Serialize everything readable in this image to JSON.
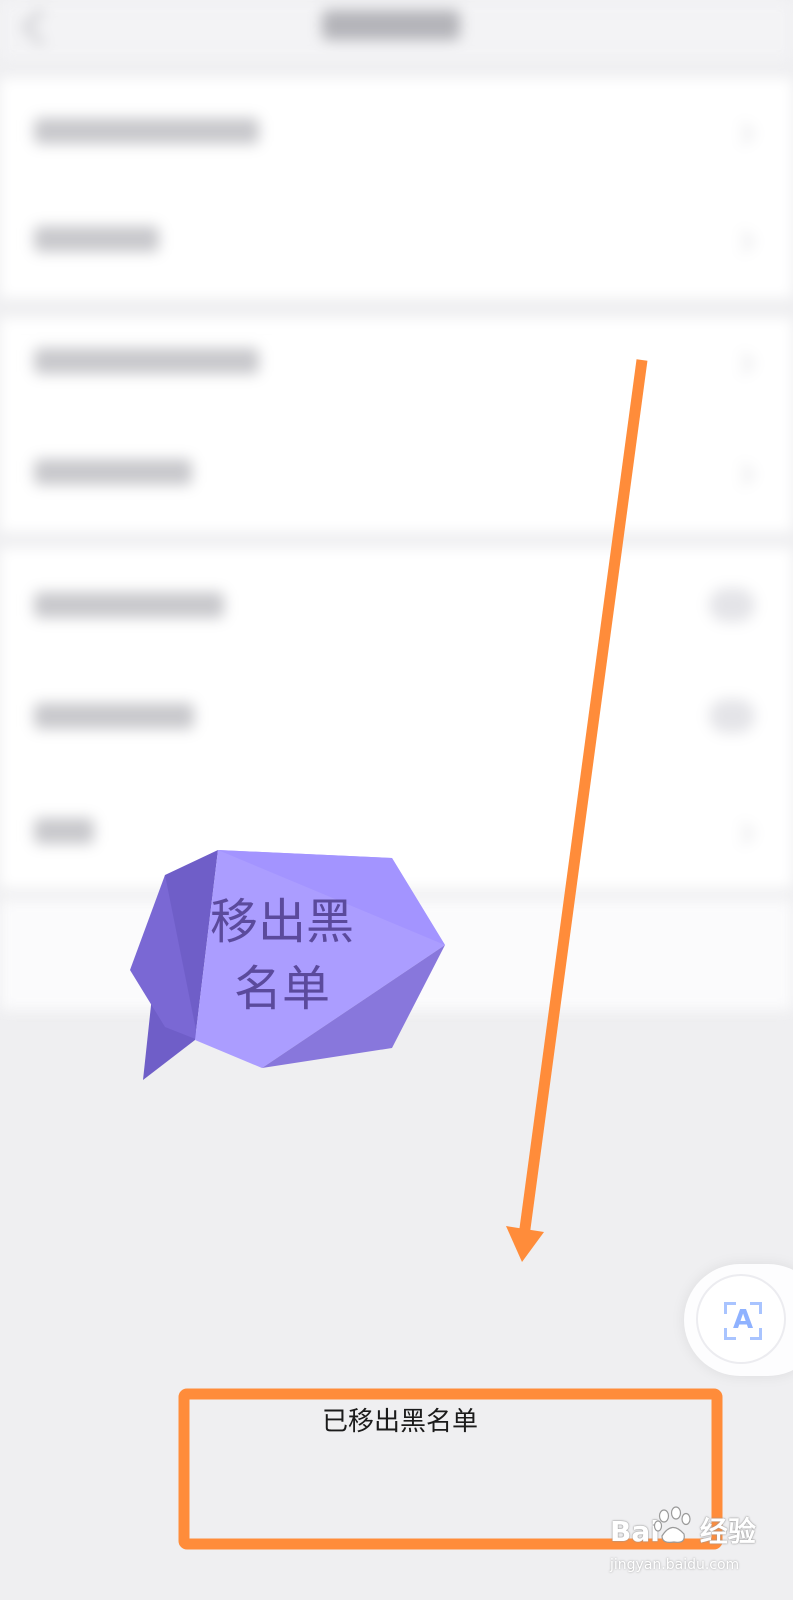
{
  "toast": {
    "message": "已移出黑名单"
  },
  "annotation": {
    "bubble_line1": "移出黑",
    "bubble_line2": "名单",
    "arrow_color": "#ff8c3a",
    "highlight_color": "#ff8c3a",
    "bubble_colors": [
      "#ab9dff",
      "#8f7ff4",
      "#6f5ec8"
    ]
  },
  "floating_button": {
    "letter": "A",
    "icon": "text-recognition-icon"
  },
  "watermark": {
    "brand": "Bai",
    "brand_suffix": "经验",
    "url": "jingyan.baidu.com"
  }
}
